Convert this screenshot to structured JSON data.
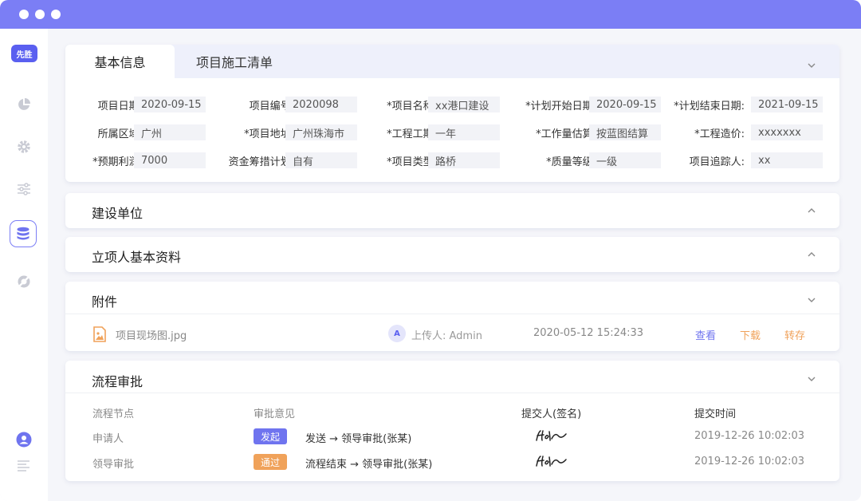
{
  "colors": {
    "accent": "#7b7ef5",
    "accent_dark": "#5a5ff0",
    "orange": "#f0a25a",
    "link_blue": "#6f74ef"
  },
  "sidebar": {
    "logo": "先胜"
  },
  "tabs": [
    {
      "label": "基本信息"
    },
    {
      "label": "项目施工清单"
    }
  ],
  "basic_info": {
    "rows": [
      [
        {
          "label": "项目日期:",
          "value": "2020-09-15"
        },
        {
          "label": "项目编号:",
          "value": "2020098"
        },
        {
          "label": "*项目名称:",
          "value": "xx港口建设"
        },
        {
          "label": "*计划开始日期:",
          "value": "2020-09-15"
        },
        {
          "label": "*计划结束日期:",
          "value": "2021-09-15"
        }
      ],
      [
        {
          "label": "所属区域:",
          "value": "广州"
        },
        {
          "label": "*项目地址:",
          "value": "广州珠海市"
        },
        {
          "label": "*工程工期:",
          "value": "一年"
        },
        {
          "label": "*工作量估算:",
          "value": "按蓝图结算"
        },
        {
          "label": "*工程造价:",
          "value": "xxxxxxx"
        }
      ],
      [
        {
          "label": "*预期利润:",
          "value": "7000"
        },
        {
          "label": "资金筹措计划:",
          "value": "自有"
        },
        {
          "label": "*项目类型:",
          "value": "路桥"
        },
        {
          "label": "*质量等级:",
          "value": "一级"
        },
        {
          "label": "项目追踪人:",
          "value": "xx"
        }
      ]
    ]
  },
  "sections": {
    "construction_unit": "建设单位",
    "project_basic_docs": "立项人基本资料",
    "attachments": "附件",
    "approval_flow": "流程审批"
  },
  "attachment": {
    "file_name": "项目现场图.jpg",
    "avatar_letter": "A",
    "uploader": "上传人: Admin",
    "time": "2020-05-12 15:24:33",
    "view": "查看",
    "download": "下载",
    "transfer": "转存"
  },
  "approval": {
    "headers": {
      "node": "流程节点",
      "opinion": "审批意见",
      "submitter": "提交人(签名)",
      "time": "提交时间"
    },
    "rows": [
      {
        "node": "申请人",
        "badge": "发起",
        "desc": "发送 → 领导审批(张某)",
        "time": "2019-12-26 10:02:03"
      },
      {
        "node": "领导审批",
        "badge": "通过",
        "desc": "流程结束 → 领导审批(张某)",
        "time": "2019-12-26 10:02:03"
      }
    ]
  }
}
